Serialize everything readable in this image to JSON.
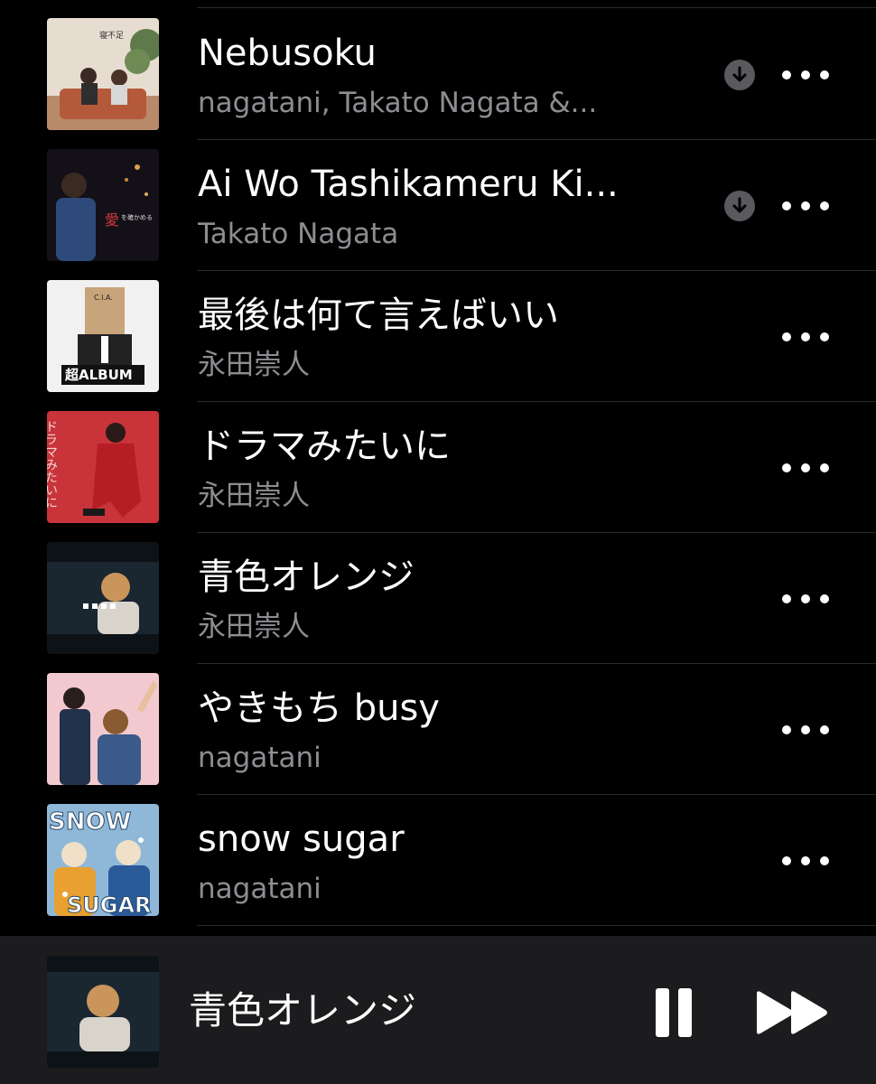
{
  "songs": [
    {
      "title": "Nebusoku",
      "artist": "nagatani, Takato Nagata &...",
      "downloadable": true,
      "art": "nebusoku-cover"
    },
    {
      "title": "Ai Wo Tashikameru Ki...",
      "artist": "Takato Nagata",
      "downloadable": true,
      "art": "ai-wo-cover"
    },
    {
      "title": "最後は何て言えばいい",
      "artist": "永田崇人",
      "downloadable": false,
      "art": "cia-album-cover",
      "art_text": "超ALBUM"
    },
    {
      "title": "ドラマみたいに",
      "artist": "永田崇人",
      "downloadable": false,
      "art": "drama-cover",
      "art_text": "ドラマみたいに"
    },
    {
      "title": "青色オレンジ",
      "artist": "永田崇人",
      "downloadable": false,
      "art": "aoiro-cover"
    },
    {
      "title": "やきもち busy",
      "artist": "nagatani",
      "downloadable": false,
      "art": "yakimochi-cover"
    },
    {
      "title": "snow sugar",
      "artist": "nagatani",
      "downloadable": false,
      "art": "snow-sugar-cover",
      "art_text_top": "SNOW",
      "art_text_bottom": "SUGAR"
    }
  ],
  "icons": {
    "download": "download-circle-icon",
    "more": "more-dots-icon",
    "pause": "pause-icon",
    "forward": "fast-forward-icon"
  },
  "now_playing": {
    "title": "青色オレンジ",
    "art": "aoiro-cover"
  },
  "colors": {
    "background": "#000000",
    "secondary_text": "#8d8d92",
    "divider": "#2a2a2a",
    "mini_player": "#1c1c1e"
  }
}
